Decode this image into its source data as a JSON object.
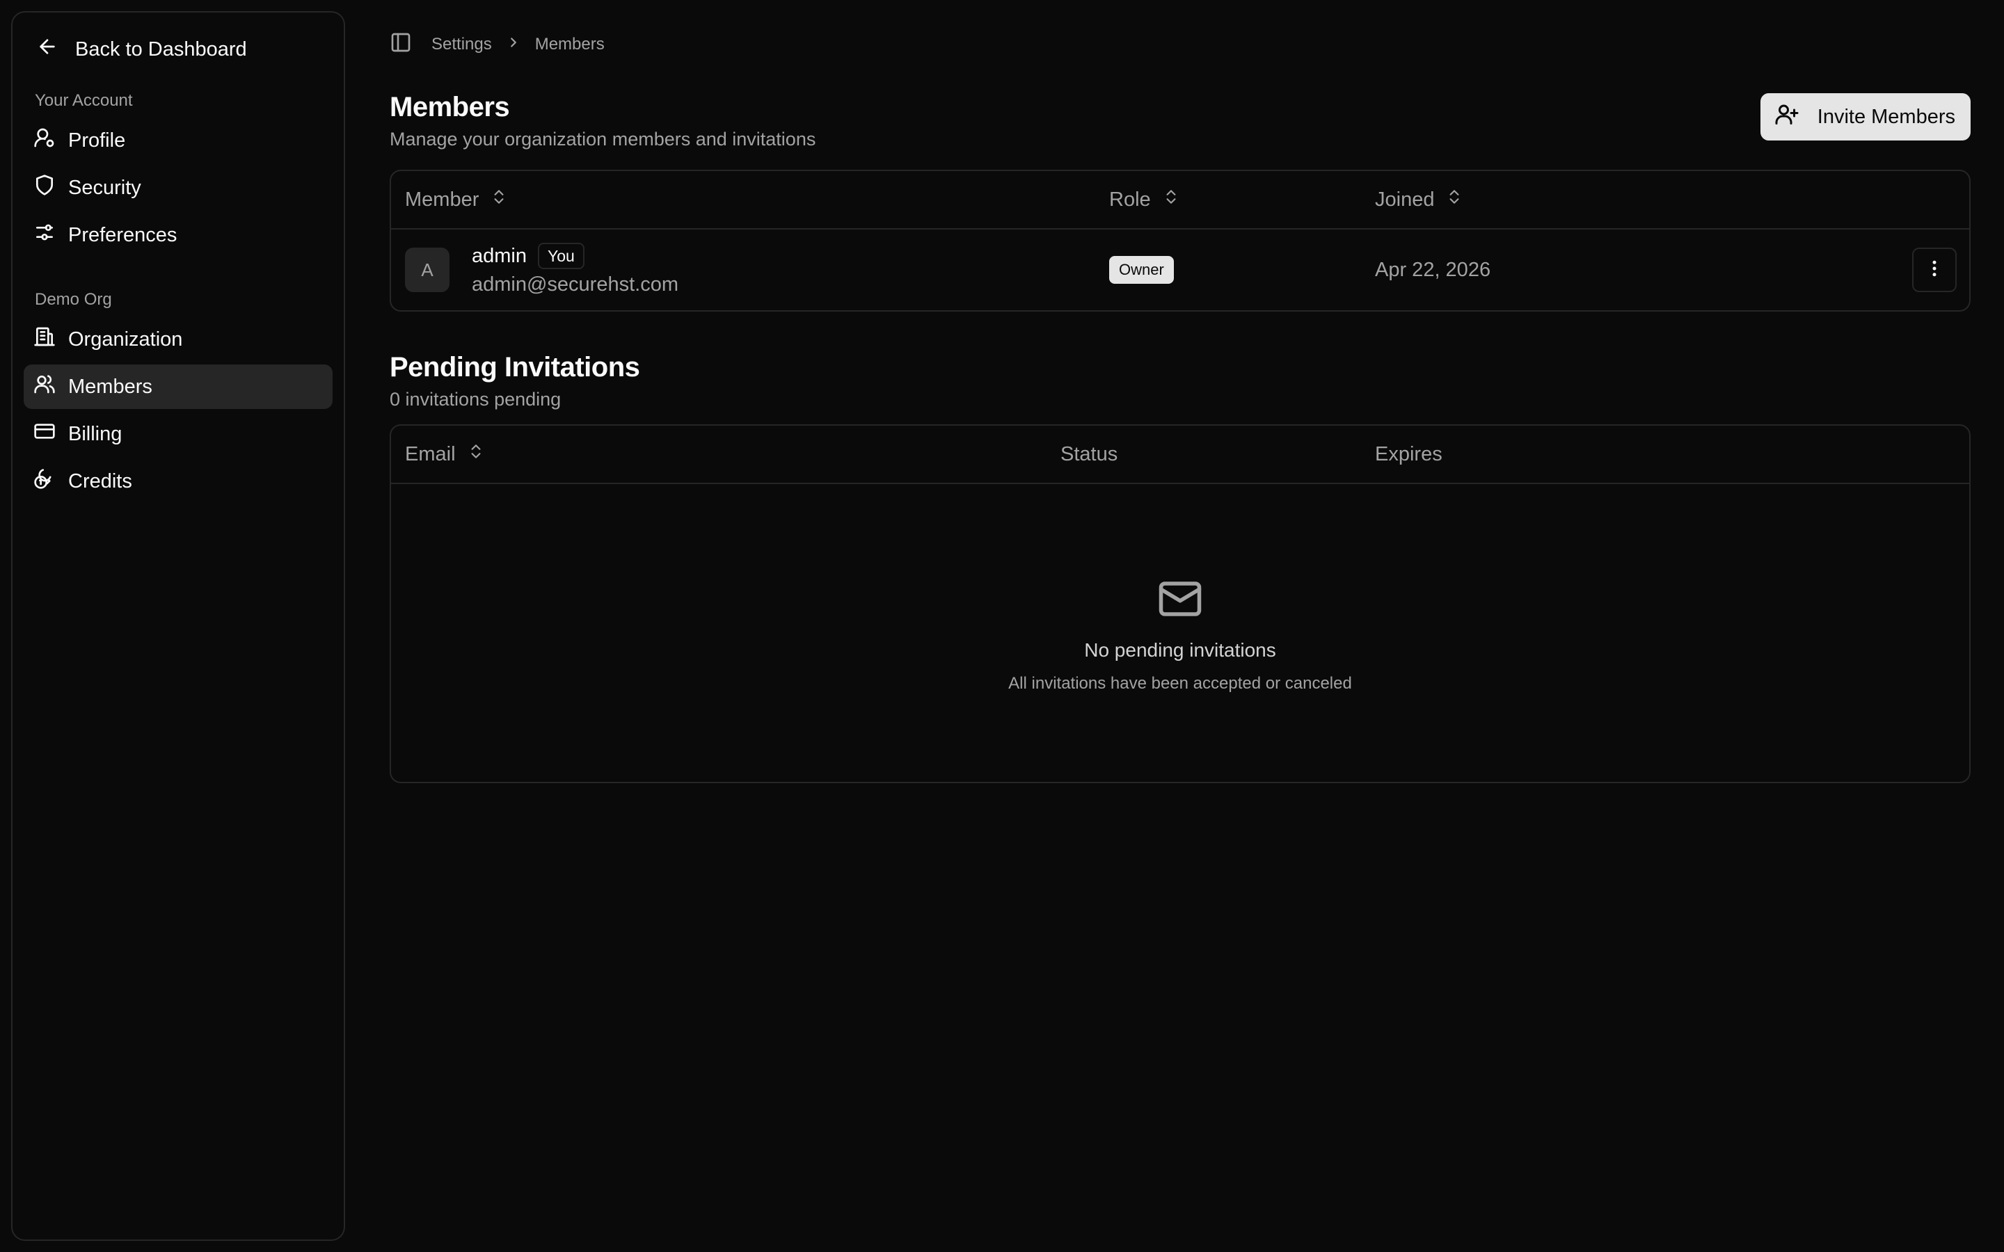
{
  "sidebar": {
    "back_label": "Back to Dashboard",
    "groups": [
      {
        "label": "Your Account",
        "items": [
          {
            "label": "Profile",
            "icon": "user-cog-icon"
          },
          {
            "label": "Security",
            "icon": "shield-icon"
          },
          {
            "label": "Preferences",
            "icon": "sliders-icon"
          }
        ]
      },
      {
        "label": "Demo Org",
        "items": [
          {
            "label": "Organization",
            "icon": "building-icon"
          },
          {
            "label": "Members",
            "icon": "users-icon",
            "active": true
          },
          {
            "label": "Billing",
            "icon": "credit-card-icon"
          },
          {
            "label": "Credits",
            "icon": "coins-icon"
          }
        ]
      }
    ]
  },
  "breadcrumb": {
    "items": [
      "Settings",
      "Members"
    ]
  },
  "members": {
    "title": "Members",
    "subtitle": "Manage your organization members and invitations",
    "invite_label": "Invite Members",
    "columns": [
      "Member",
      "Role",
      "Joined"
    ],
    "rows": [
      {
        "initial": "A",
        "name": "admin",
        "you_badge": "You",
        "email": "admin@securehst.com",
        "role": "Owner",
        "joined": "Apr 22, 2026"
      }
    ]
  },
  "invitations": {
    "title": "Pending Invitations",
    "subtitle": "0 invitations pending",
    "columns": [
      "Email",
      "Status",
      "Expires"
    ],
    "empty_title": "No pending invitations",
    "empty_subtitle": "All invitations have been accepted or canceled"
  },
  "colors": {
    "background": "#0a0a0a",
    "border": "#262626",
    "muted_text": "#a3a3a3",
    "button_bg": "#e5e5e5",
    "active_item_bg": "#262626"
  }
}
